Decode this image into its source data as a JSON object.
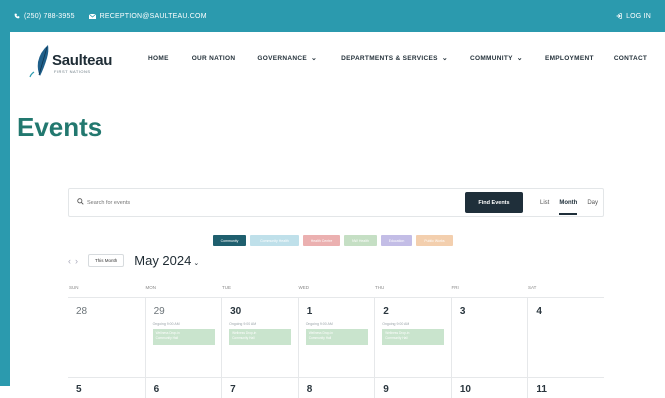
{
  "topbar": {
    "phone": "(250) 788-3955",
    "email": "RECEPTION@SAULTEAU.COM",
    "login": "LOG IN"
  },
  "logo": {
    "name": "Saulteau",
    "subtitle": "FIRST NATIONS"
  },
  "nav": [
    {
      "label": "HOME",
      "dropdown": false
    },
    {
      "label": "OUR NATION",
      "dropdown": false
    },
    {
      "label": "GOVERNANCE",
      "dropdown": true
    },
    {
      "label": "DEPARTMENTS & SERVICES",
      "dropdown": true
    },
    {
      "label": "COMMUNITY",
      "dropdown": true
    },
    {
      "label": "EMPLOYMENT",
      "dropdown": false
    },
    {
      "label": "CONTACT",
      "dropdown": false
    }
  ],
  "page_title": "Events",
  "search": {
    "placeholder": "Search for events",
    "button": "Find Events",
    "views": [
      "List",
      "Month",
      "Day"
    ],
    "active_view": "Month"
  },
  "filters": [
    {
      "label": "Community",
      "color": "#1f5f6e"
    },
    {
      "label": "Community Health",
      "color": "#bfe0ea"
    },
    {
      "label": "Health Centre",
      "color": "#ebb0b0"
    },
    {
      "label": "NW Health",
      "color": "#c5dfc4"
    },
    {
      "label": "Education",
      "color": "#c3bde6"
    },
    {
      "label": "Public Works",
      "color": "#f3cfae"
    }
  ],
  "calendar": {
    "this_month": "This Month",
    "month_label": "May 2024",
    "days_of_week": [
      "SUN",
      "MON",
      "TUE",
      "WED",
      "THU",
      "FRI",
      "SAT"
    ],
    "week1": [
      {
        "day": "28",
        "past": true,
        "event": null
      },
      {
        "day": "29",
        "past": true,
        "event": {
          "time": "Ongoing 9:00 AM",
          "title": "Wellness Drop-in",
          "location": "Community Hall"
        }
      },
      {
        "day": "30",
        "past": false,
        "event": {
          "time": "Ongoing 9:00 AM",
          "title": "Wellness Drop-in",
          "location": "Community Hall"
        }
      },
      {
        "day": "1",
        "past": false,
        "event": {
          "time": "Ongoing 9:00 AM",
          "title": "Wellness Drop-in",
          "location": "Community Hall"
        }
      },
      {
        "day": "2",
        "past": false,
        "event": {
          "time": "Ongoing 9:00 AM",
          "title": "Wellness Drop-in",
          "location": "Community Hall"
        }
      },
      {
        "day": "3",
        "past": false,
        "event": null
      },
      {
        "day": "4",
        "past": false,
        "event": null
      }
    ],
    "week2": [
      "5",
      "6",
      "7",
      "8",
      "9",
      "10",
      "11"
    ]
  }
}
